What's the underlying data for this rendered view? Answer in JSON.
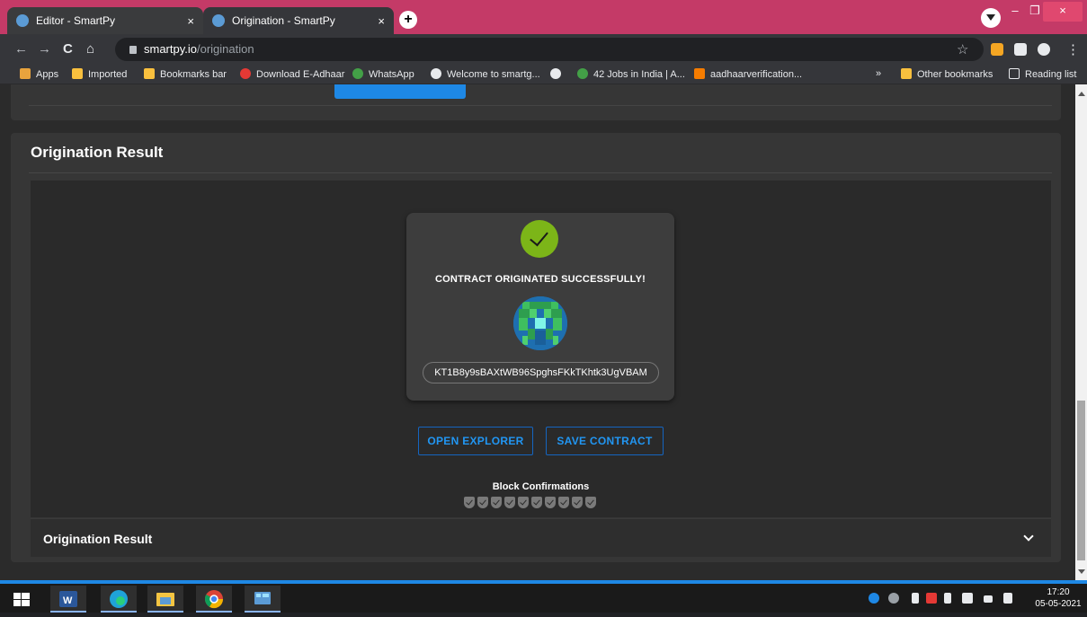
{
  "browser": {
    "tabs": [
      {
        "title": "Editor - SmartPy",
        "close": "×"
      },
      {
        "title": "Origination - SmartPy",
        "close": "×"
      }
    ],
    "new_tab": "+",
    "window_controls": {
      "minimize": "–",
      "maximize": "❐",
      "close": "×"
    },
    "nav": {
      "back": "←",
      "forward": "→",
      "reload": "C",
      "home": "⌂"
    },
    "url": {
      "host": "smartpy.io",
      "path": "/origination"
    },
    "star": "☆",
    "menu": "⋮"
  },
  "bookmarks": {
    "items": [
      {
        "label": "Apps",
        "color": "#e8a33d"
      },
      {
        "label": "Imported",
        "color": "#f9c03e"
      },
      {
        "label": "Bookmarks bar",
        "color": "#f9c03e"
      },
      {
        "label": "Download E-Adhaar",
        "color": "#e53935"
      },
      {
        "label": "WhatsApp",
        "color": "#43a047"
      },
      {
        "label": "Welcome to smartg...",
        "color": "#e8eaed"
      },
      {
        "label": "42 Jobs in India | A...",
        "color": "#43a047"
      },
      {
        "label": "aadhaarverification...",
        "color": "#f57c00"
      }
    ],
    "overflow": "»",
    "other": "Other bookmarks",
    "reading_list": "Reading list"
  },
  "page": {
    "result_title": "Origination Result",
    "success_message": "CONTRACT ORIGINATED SUCCESSFULLY!",
    "contract_address": "KT1B8y9sBAXtWB96SpghsFKkTKhtk3UgVBAM",
    "open_explorer_label": "OPEN EXPLORER",
    "save_contract_label": "SAVE CONTRACT",
    "block_confirmations_label": "Block Confirmations",
    "block_confirmations_count": 10,
    "accordion_title": "Origination Result",
    "colors": {
      "accent": "#2196f3",
      "success": "#7cb518",
      "card": "#363636"
    }
  },
  "taskbar": {
    "apps": [
      "windows-start",
      "word",
      "edge",
      "file-explorer",
      "chrome",
      "control-panel"
    ],
    "time": "17:20",
    "date": "05-05-2021"
  }
}
